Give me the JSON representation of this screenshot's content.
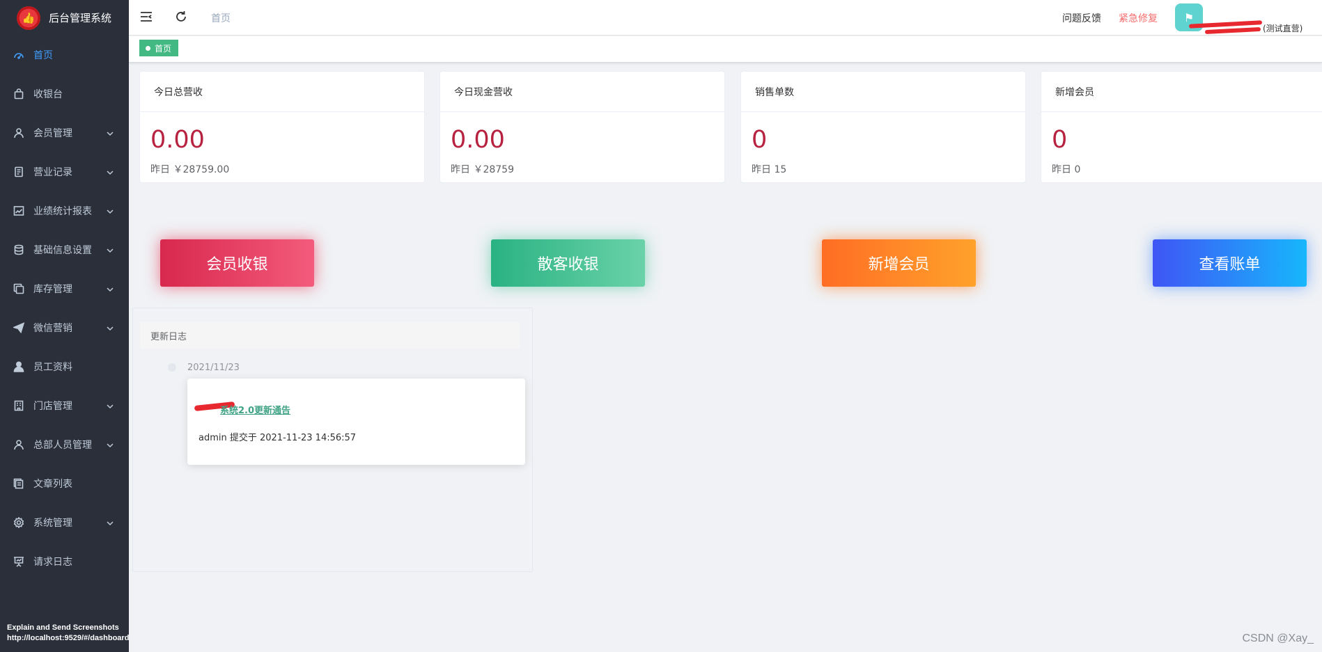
{
  "app": {
    "title": "后台管理系统",
    "logo_icon": "thumbs-up-icon"
  },
  "sidebar": {
    "items": [
      {
        "label": "首页",
        "icon": "dashboard-icon",
        "active": true,
        "has_children": false
      },
      {
        "label": "收银台",
        "icon": "shopping-bag-icon",
        "active": false,
        "has_children": false
      },
      {
        "label": "会员管理",
        "icon": "user-icon",
        "active": false,
        "has_children": true
      },
      {
        "label": "营业记录",
        "icon": "document-icon",
        "active": false,
        "has_children": true
      },
      {
        "label": "业绩统计报表",
        "icon": "chart-icon",
        "active": false,
        "has_children": true
      },
      {
        "label": "基础信息设置",
        "icon": "database-icon",
        "active": false,
        "has_children": true
      },
      {
        "label": "库存管理",
        "icon": "copy-icon",
        "active": false,
        "has_children": true
      },
      {
        "label": "微信营销",
        "icon": "paper-plane-icon",
        "active": false,
        "has_children": true
      },
      {
        "label": "员工资料",
        "icon": "person-icon",
        "active": false,
        "has_children": false
      },
      {
        "label": "门店管理",
        "icon": "building-icon",
        "active": false,
        "has_children": true
      },
      {
        "label": "总部人员管理",
        "icon": "user-icon",
        "active": false,
        "has_children": true
      },
      {
        "label": "文章列表",
        "icon": "list-icon",
        "active": false,
        "has_children": false
      },
      {
        "label": "系统管理",
        "icon": "gear-icon",
        "active": false,
        "has_children": true
      },
      {
        "label": "请求日志",
        "icon": "presentation-icon",
        "active": false,
        "has_children": false
      }
    ],
    "overlay": {
      "line1": "Explain and Send Screenshots",
      "line2": "http://localhost:9529/#/dashboard"
    }
  },
  "topbar": {
    "breadcrumb": "首页",
    "feedback": "问题反馈",
    "emergency_fix": "紧急修复",
    "user_suffix": "(测试直营)",
    "avatar_icon": "avatar-icon"
  },
  "tags": {
    "current": "首页"
  },
  "stats": [
    {
      "title": "今日总营收",
      "value": "0.00",
      "sub": "昨日 ￥28759.00"
    },
    {
      "title": "今日现金营收",
      "value": "0.00",
      "sub": "昨日 ￥28759"
    },
    {
      "title": "销售单数",
      "value": "0",
      "sub": "昨日 15"
    },
    {
      "title": "新增会员",
      "value": "0",
      "sub": "昨日 0"
    }
  ],
  "actions": [
    {
      "label": "会员收银"
    },
    {
      "label": "散客收银"
    },
    {
      "label": "新增会员"
    },
    {
      "label": "查看账单"
    }
  ],
  "changelog": {
    "title": "更新日志",
    "entries": [
      {
        "date": "2021/11/23",
        "title": "系统2.0更新通告",
        "meta": "admin 提交于 2021-11-23 14:56:57"
      }
    ]
  },
  "watermark": "CSDN @Xay_",
  "colors": {
    "sidebar_bg": "#2b2f3a",
    "active_menu": "#409eff",
    "tag_green": "#42b983",
    "stat_value": "#b72240",
    "emergency": "#f56c6c"
  }
}
